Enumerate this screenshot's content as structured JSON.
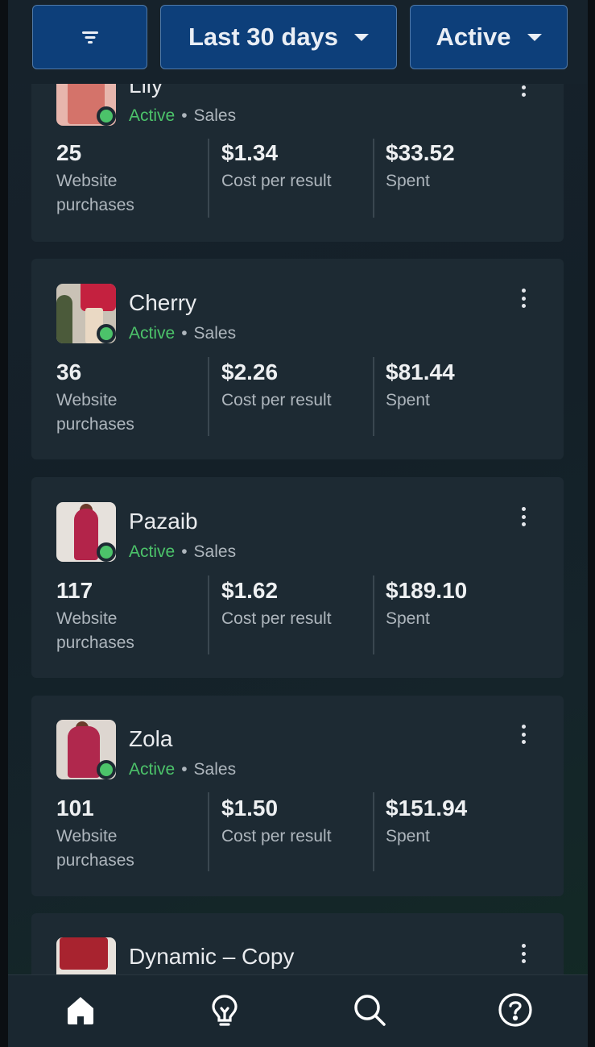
{
  "filters": {
    "date_label": "Last 30 days",
    "status_label": "Active"
  },
  "ads": [
    {
      "name": "Lily",
      "status": "Active",
      "objective": "Sales",
      "results": "25",
      "results_label": "Website purchases",
      "cost_per_result": "$1.34",
      "cost_per_result_label": "Cost per result",
      "spent": "$33.52",
      "spent_label": "Spent"
    },
    {
      "name": "Cherry",
      "status": "Active",
      "objective": "Sales",
      "results": "36",
      "results_label": "Website purchases",
      "cost_per_result": "$2.26",
      "cost_per_result_label": "Cost per result",
      "spent": "$81.44",
      "spent_label": "Spent"
    },
    {
      "name": "Pazaib",
      "status": "Active",
      "objective": "Sales",
      "results": "117",
      "results_label": "Website purchases",
      "cost_per_result": "$1.62",
      "cost_per_result_label": "Cost per result",
      "spent": "$189.10",
      "spent_label": "Spent"
    },
    {
      "name": "Zola",
      "status": "Active",
      "objective": "Sales",
      "results": "101",
      "results_label": "Website purchases",
      "cost_per_result": "$1.50",
      "cost_per_result_label": "Cost per result",
      "spent": "$151.94",
      "spent_label": "Spent"
    },
    {
      "name": "Dynamic – Copy"
    }
  ],
  "nav": {
    "items": [
      "home-icon",
      "lightbulb-icon",
      "search-icon",
      "help-icon"
    ],
    "active": "home-icon"
  },
  "colors": {
    "accent": "#0d3f7a",
    "active_status": "#4cc36a",
    "card_bg": "#1d2a33"
  }
}
